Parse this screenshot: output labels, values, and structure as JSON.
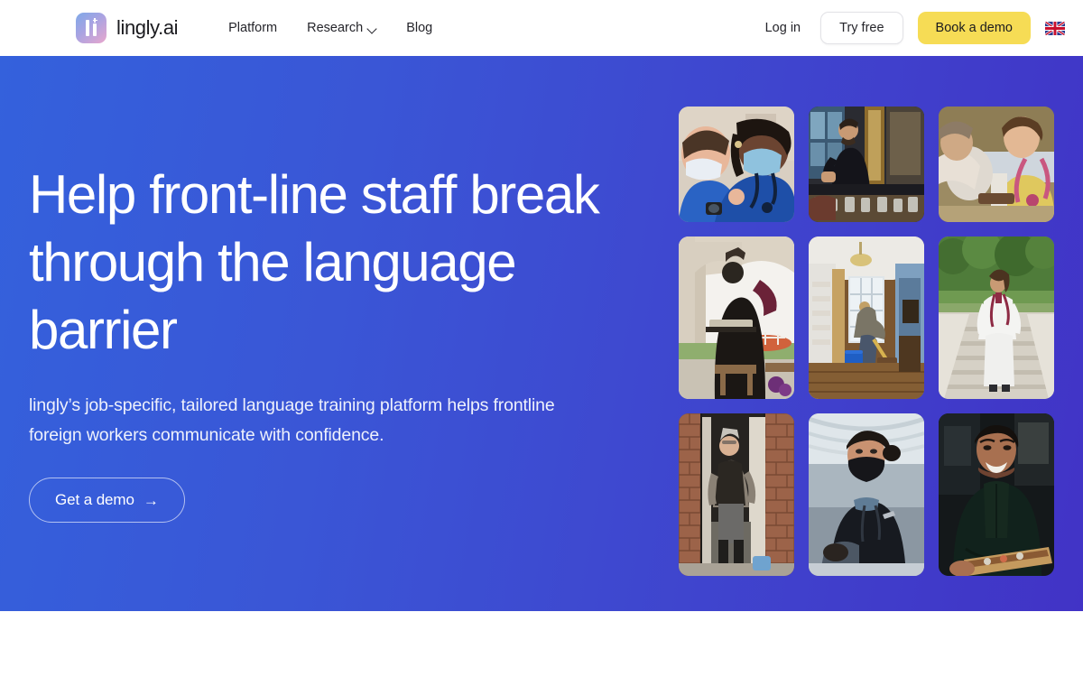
{
  "header": {
    "brand": {
      "name": "lingly.ai",
      "logo_icon": "lingly-logo-icon"
    },
    "nav": [
      {
        "label": "Platform",
        "has_chevron": false
      },
      {
        "label": "Research",
        "has_chevron": true
      },
      {
        "label": "Blog",
        "has_chevron": false
      }
    ],
    "login_label": "Log in",
    "try_free_label": "Try free",
    "book_demo_label": "Book a demo",
    "language_flag": "uk-flag-icon",
    "book_demo_color": "#f6dc55",
    "background": "#ffffff"
  },
  "hero": {
    "headline": "Help front-line staff break through the language barrier",
    "subheadline": "lingly’s job-specific, tailored language training platform helps frontline foreign workers communicate with confidence.",
    "cta_label": "Get a demo",
    "cta_arrow": "→",
    "gradient_from": "#3461dc",
    "gradient_to": "#4133c6",
    "text_color": "#ffffff"
  },
  "image_grid": {
    "columns": 3,
    "rows": 3,
    "tiles": [
      {
        "alt": "Two nurses in blue scrubs wearing face masks greeting each other",
        "scene": "nurses"
      },
      {
        "alt": "Bartender in black shirt smiling behind a bar with glassware",
        "scene": "bartender"
      },
      {
        "alt": "Smiling care worker in yellow uniform with stethoscope assisting a patient",
        "scene": "careworker"
      },
      {
        "alt": "Hospitality worker carrying a tray under an archway on a sunny terrace",
        "scene": "waiter"
      },
      {
        "alt": "Cleaner mopping the wooden floor of a hallway with a blue bucket",
        "scene": "cleaner"
      },
      {
        "alt": "Nurse in white uniform standing on outdoor stone steps surrounded by trees",
        "scene": "nurse-outdoor"
      },
      {
        "alt": "Older man in an apron standing in a brick doorway",
        "scene": "doorway"
      },
      {
        "alt": "Flight attendant in dark uniform and face mask serving on board a plane",
        "scene": "flight-attendant"
      },
      {
        "alt": "Smiling chef in dark chef jacket holding a wooden serving board",
        "scene": "chef"
      }
    ]
  }
}
